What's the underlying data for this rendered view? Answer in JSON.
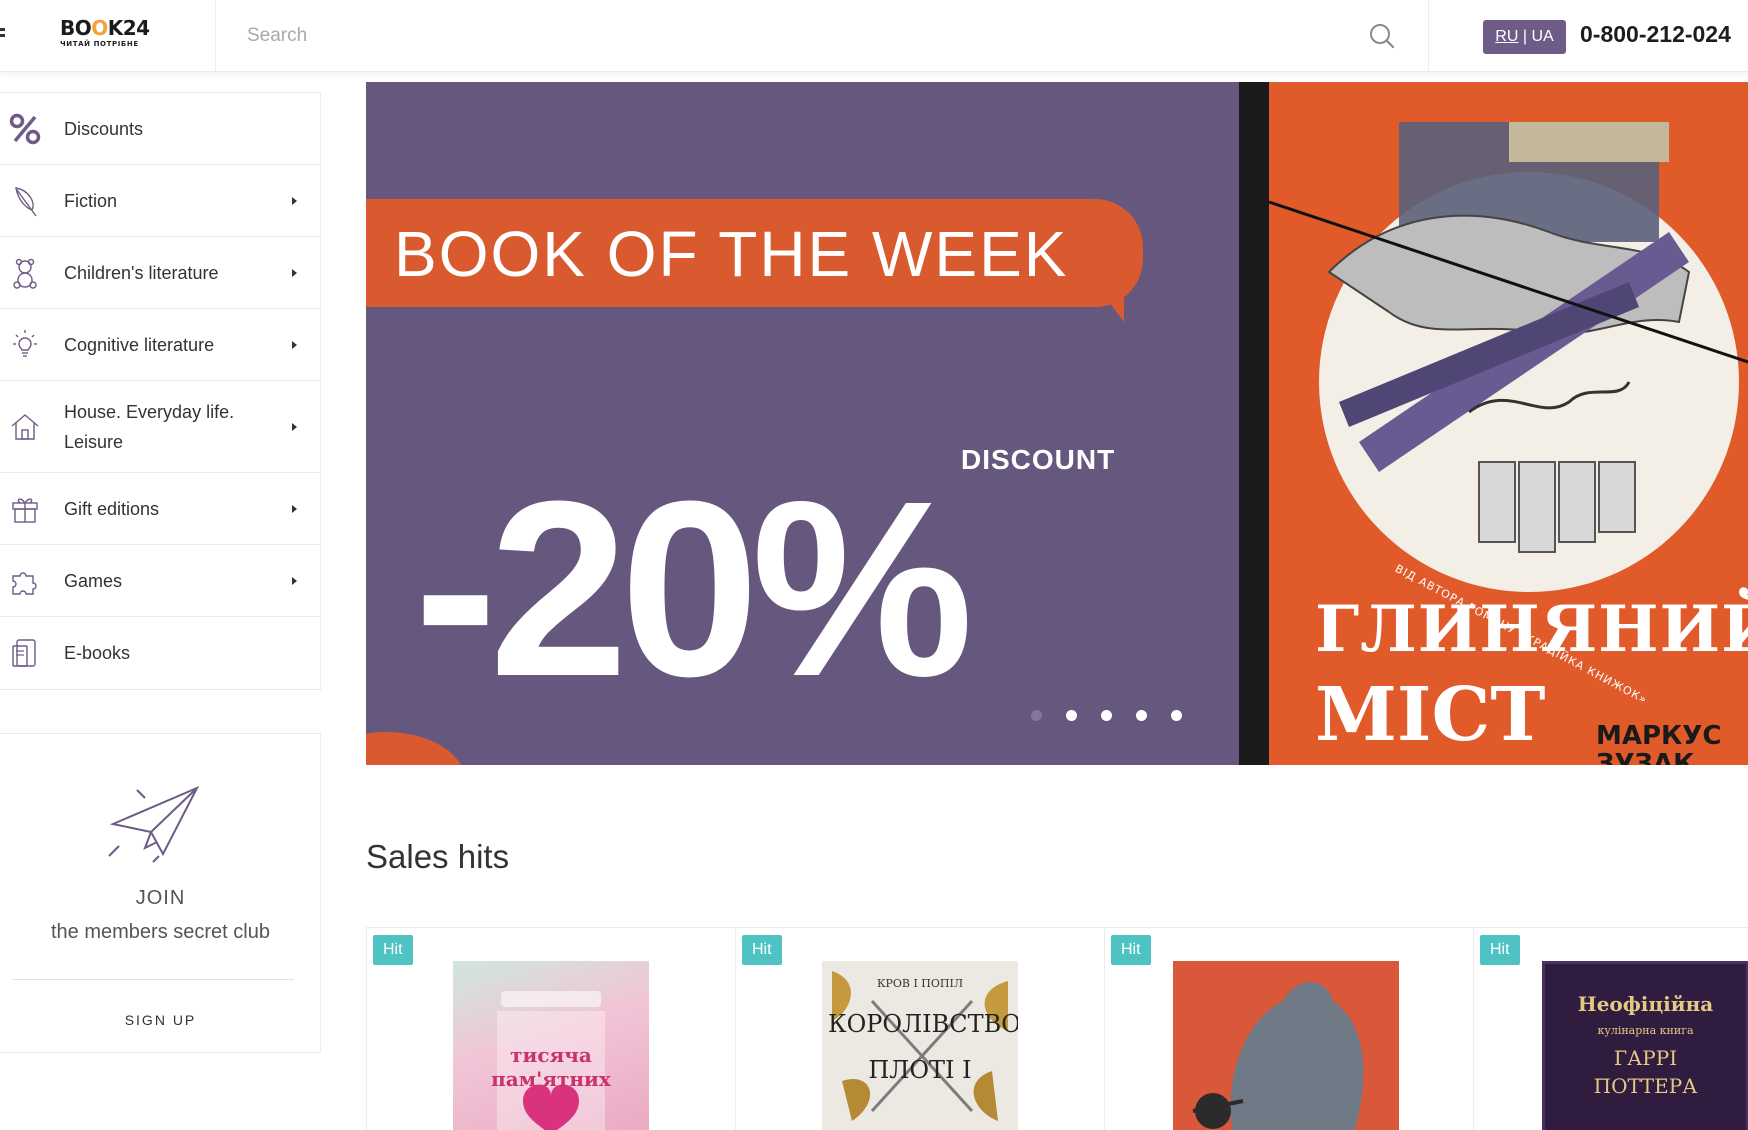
{
  "header": {
    "logo_main_pre": "BO",
    "logo_main_o": "O",
    "logo_main_post": "K24",
    "logo_sub": "ЧИТАЙ ПОТРІБНЕ",
    "search_placeholder": "Search",
    "lang_ru": "RU",
    "lang_sep": " | ",
    "lang_ua": "UA",
    "phone": "0-800-212-024"
  },
  "sidebar": {
    "items": [
      {
        "label": "Discounts",
        "icon": "percent-icon",
        "has_arrow": false
      },
      {
        "label": "Fiction",
        "icon": "feather-icon",
        "has_arrow": true
      },
      {
        "label": "Children's literature",
        "icon": "teddy-bear-icon",
        "has_arrow": true
      },
      {
        "label": "Cognitive literature",
        "icon": "lightbulb-icon",
        "has_arrow": true
      },
      {
        "label": "House. Everyday life. Leisure",
        "icon": "house-icon",
        "has_arrow": true
      },
      {
        "label": "Gift editions",
        "icon": "gift-icon",
        "has_arrow": true
      },
      {
        "label": "Games",
        "icon": "puzzle-icon",
        "has_arrow": true
      },
      {
        "label": "E-books",
        "icon": "ebook-icon",
        "has_arrow": false
      }
    ]
  },
  "club": {
    "join": "JOIN",
    "text": "the members secret club",
    "signup": "SIGN UP"
  },
  "banner": {
    "heading": "BOOK OF THE WEEK",
    "discount_label": "DISCOUNT",
    "discount_value": "-20%",
    "slide_count": 5,
    "active_slide": 1,
    "cover_tagline": "ВІД АВТОРА РОМАНУ «КРАДІЙКА КНИЖОК»",
    "cover_title_line1": "ГЛИНЯНИЙ",
    "cover_title_line2": "МІСТ",
    "cover_author": "МАРКУС ЗУЗАК"
  },
  "sales_hits": {
    "title": "Sales hits",
    "badge": "Hit",
    "products": [
      {
        "cover_text": "тисяча пам'ятних"
      },
      {
        "cover_text_top": "КРОВ І ПОПІЛ",
        "cover_text": "КОРОЛІВСТВО ПЛОТІ І"
      },
      {
        "cover_text": ""
      },
      {
        "cover_text_top": "Неофіційна",
        "cover_text_mid": "кулінарна книга",
        "cover_text": "ГАРРІ ПОТТЕРА"
      }
    ]
  },
  "colors": {
    "brand_purple": "#65577d",
    "accent_orange": "#d95a2e",
    "hit_badge": "#4fc3c3",
    "logo_orange": "#f3a43a"
  }
}
